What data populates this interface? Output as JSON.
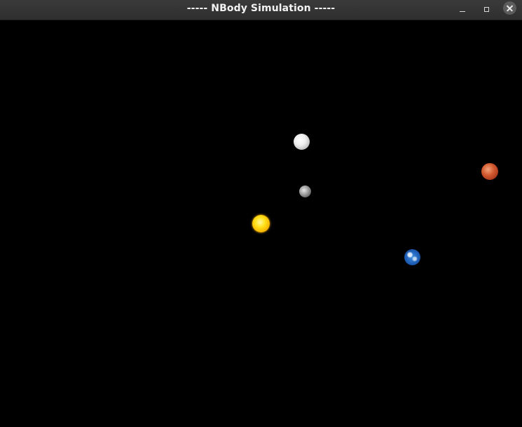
{
  "window": {
    "title": "----- NBody Simulation -----",
    "controls": {
      "minimize_icon": "minimize-icon",
      "maximize_icon": "maximize-icon",
      "close_icon": "close-icon"
    }
  },
  "canvas": {
    "background": "#000000",
    "bodies": [
      {
        "name": "sun",
        "color": "#ffd600"
      },
      {
        "name": "moon",
        "color": "#f0f0f0"
      },
      {
        "name": "mercury",
        "color": "#8c8c8c"
      },
      {
        "name": "mars",
        "color": "#c0482a"
      },
      {
        "name": "earth",
        "color": "#2a6bd0"
      }
    ]
  }
}
